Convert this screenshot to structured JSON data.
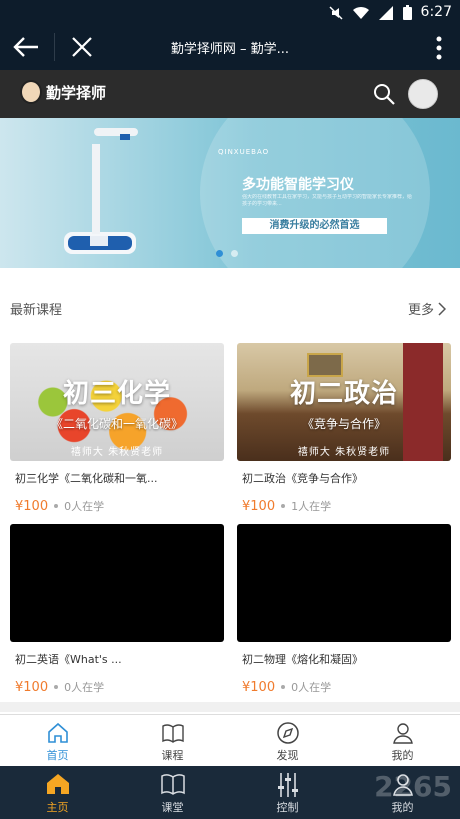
{
  "status_bar": {
    "time": "6:27"
  },
  "title_bar": {
    "title": "勤学择师网 – 勤学..."
  },
  "app_header": {
    "brand": "勤学择师"
  },
  "banner": {
    "small_text": "QINXUEBAO",
    "headline": "多功能智能学习仪",
    "description": "强大的在线教育工具在家学习，又能与孩子互动学习的智能家长专家推荐，给孩子的学习带来...",
    "cta": "消费升级的必然首选"
  },
  "section": {
    "title": "最新课程",
    "more": "更多"
  },
  "courses": [
    {
      "banner_title": "初三化学",
      "banner_subtitle": "《二氧化碳和一氧化碳》",
      "teacher": "禧师大  朱秋贤老师",
      "name": "初三化学《二氧化碳和一氧...",
      "price": "¥100",
      "learners": "0人在学"
    },
    {
      "banner_title": "初二政治",
      "banner_subtitle": "《竞争与合作》",
      "teacher": "禧师大  朱秋贤老师",
      "name": "初二政治《竞争与合作》",
      "price": "¥100",
      "learners": "1人在学"
    },
    {
      "name": "初二英语《What's ...",
      "price": "¥100",
      "learners": "0人在学"
    },
    {
      "name": "初二物理《熔化和凝固》",
      "price": "¥100",
      "learners": "0人在学"
    }
  ],
  "tabbar_web": [
    {
      "label": "首页",
      "icon": "home-icon"
    },
    {
      "label": "课程",
      "icon": "book-icon"
    },
    {
      "label": "发现",
      "icon": "compass-icon"
    },
    {
      "label": "我的",
      "icon": "person-icon"
    }
  ],
  "tabbar_app": [
    {
      "label": "主页",
      "icon": "home-icon"
    },
    {
      "label": "课堂",
      "icon": "book-icon"
    },
    {
      "label": "控制",
      "icon": "sliders-icon"
    },
    {
      "label": "我的",
      "icon": "person-icon"
    }
  ],
  "watermark": "2265",
  "colors": {
    "accent_blue": "#2f8fd6",
    "price_orange": "#f07b2d",
    "active_orange": "#f5a623",
    "dark_bar": "#0d1c2b"
  }
}
